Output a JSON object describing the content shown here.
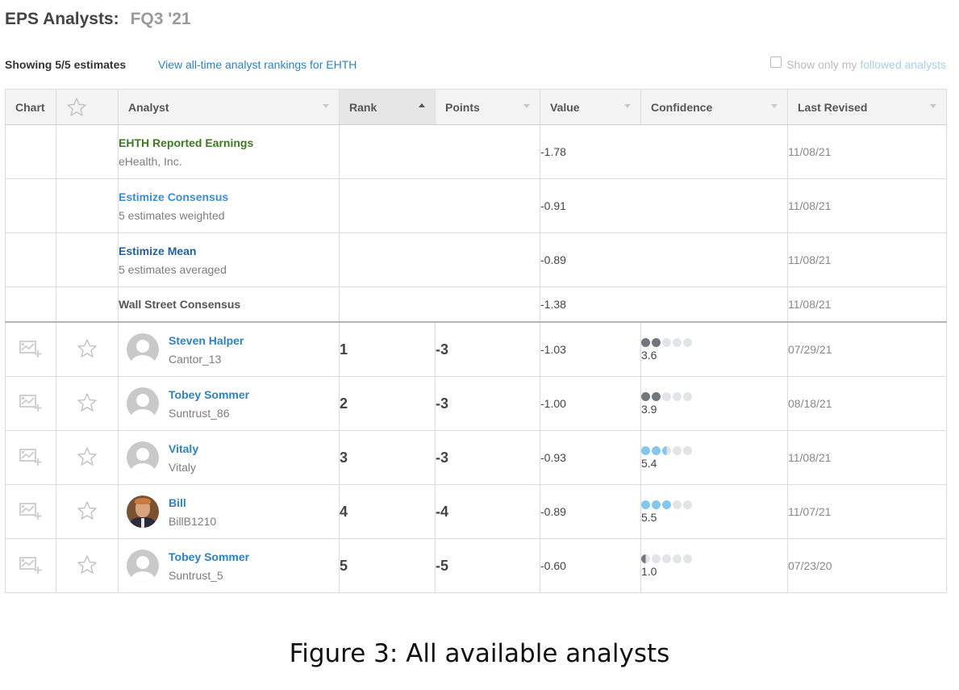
{
  "header": {
    "title": "EPS Analysts:",
    "period": "FQ3 '21"
  },
  "toolbar": {
    "showing": "Showing 5/5 estimates",
    "rankings_link": "View all-time analyst rankings for EHTH",
    "follow_prefix": "Show only my",
    "follow_link": "followed analysts"
  },
  "columns": {
    "chart": "Chart",
    "analyst": "Analyst",
    "rank": "Rank",
    "points": "Points",
    "value": "Value",
    "confidence": "Confidence",
    "last_revised": "Last Revised"
  },
  "reference_rows": [
    {
      "name": "EHTH Reported Earnings",
      "sub": "eHealth, Inc.",
      "value": "-1.78",
      "date": "11/08/21"
    },
    {
      "name": "Estimize Consensus",
      "sub": "5 estimates weighted",
      "value": "-0.91",
      "date": "11/08/21"
    },
    {
      "name": "Estimize Mean",
      "sub": "5 estimates averaged",
      "value": "-0.89",
      "date": "11/08/21"
    },
    {
      "name": "Wall Street Consensus",
      "value": "-1.38",
      "date": "11/08/21"
    }
  ],
  "analysts": [
    {
      "name": "Steven Halper",
      "handle": "Cantor_13",
      "rank": "1",
      "points": "-3",
      "value": "-1.03",
      "confidence": "3.6",
      "dots": [
        "dark",
        "dark",
        "empty",
        "empty",
        "empty"
      ],
      "date": "07/29/21",
      "avatar": "placeholder"
    },
    {
      "name": "Tobey Sommer",
      "handle": "Suntrust_86",
      "rank": "2",
      "points": "-3",
      "value": "-1.00",
      "confidence": "3.9",
      "dots": [
        "dark",
        "dark",
        "empty",
        "empty",
        "empty"
      ],
      "date": "08/18/21",
      "avatar": "placeholder"
    },
    {
      "name": "Vitaly",
      "handle": "Vitaly",
      "rank": "3",
      "points": "-3",
      "value": "-0.93",
      "confidence": "5.4",
      "dots": [
        "light",
        "light",
        "half-light",
        "empty",
        "empty"
      ],
      "date": "11/08/21",
      "avatar": "placeholder"
    },
    {
      "name": "Bill",
      "handle": "BillB1210",
      "rank": "4",
      "points": "-4",
      "value": "-0.89",
      "confidence": "5.5",
      "dots": [
        "light",
        "light",
        "light",
        "empty",
        "empty"
      ],
      "date": "11/07/21",
      "avatar": "photo"
    },
    {
      "name": "Tobey Sommer",
      "handle": "Suntrust_5",
      "rank": "5",
      "points": "-5",
      "value": "-0.60",
      "confidence": "1.0",
      "dots": [
        "half-dark",
        "empty",
        "empty",
        "empty",
        "empty"
      ],
      "date": "07/23/20",
      "avatar": "placeholder"
    }
  ],
  "caption": "Figure 3: All available analysts"
}
